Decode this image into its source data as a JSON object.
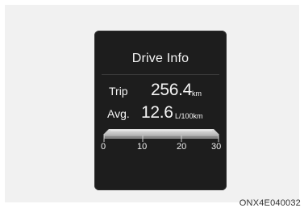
{
  "display": {
    "title": "Drive Info",
    "trip": {
      "label": "Trip",
      "value": "256.4",
      "unit": "km"
    },
    "average": {
      "label": "Avg.",
      "value": "12.6",
      "unit": "L/100km"
    },
    "gauge": {
      "ticks": [
        "0",
        "10",
        "20",
        "30"
      ],
      "min": 0,
      "max": 30,
      "level": 12.6
    }
  },
  "figure_code": "ONX4E040032",
  "colors": {
    "display_background": "#1d1d1d",
    "text": "#f4f4f4",
    "gauge_bar": "#c7c7c7"
  }
}
